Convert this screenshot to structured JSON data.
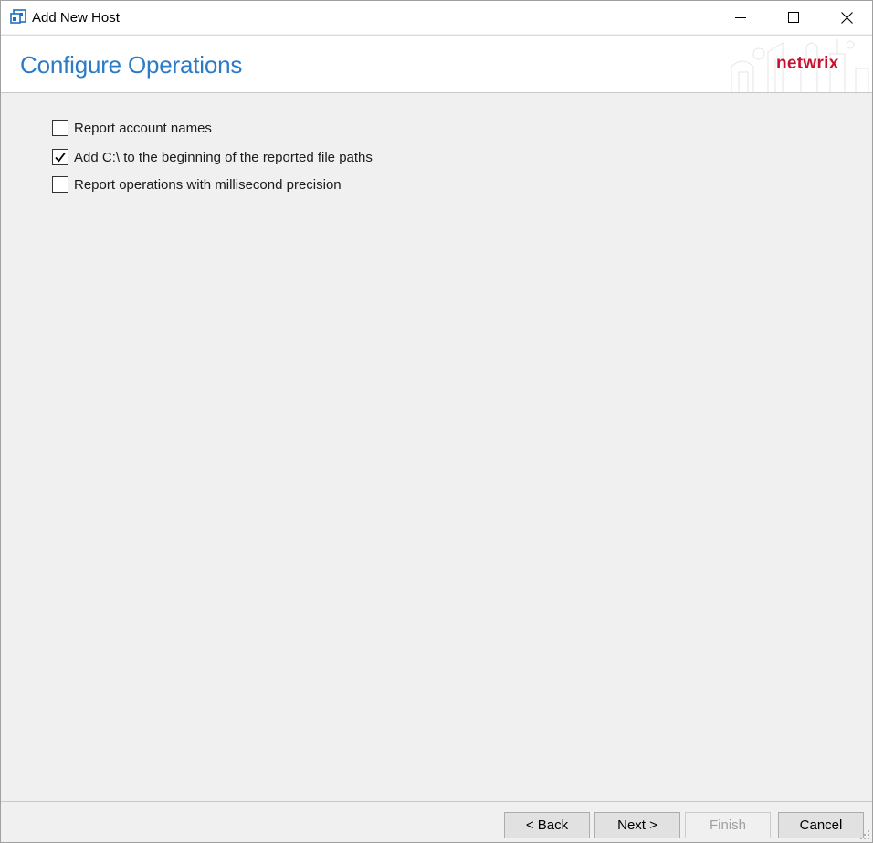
{
  "window": {
    "title": "Add New Host",
    "icon": "app-icon",
    "controls": {
      "minimize_icon": "minimize-icon",
      "maximize_icon": "maximize-icon",
      "close_icon": "close-icon"
    }
  },
  "header": {
    "title": "Configure Operations",
    "title_color": "#2b7bc7",
    "brand": "netwrix",
    "brand_color": "#c8102e"
  },
  "options": [
    {
      "label": "Report account names",
      "checked": false
    },
    {
      "label": "Add C:\\ to the beginning of the reported file paths",
      "checked": true
    },
    {
      "label": "Report operations with millisecond precision",
      "checked": false
    }
  ],
  "footer": {
    "back_label": "< Back",
    "next_label": "Next >",
    "finish_label": "Finish",
    "finish_enabled": false,
    "cancel_label": "Cancel"
  }
}
